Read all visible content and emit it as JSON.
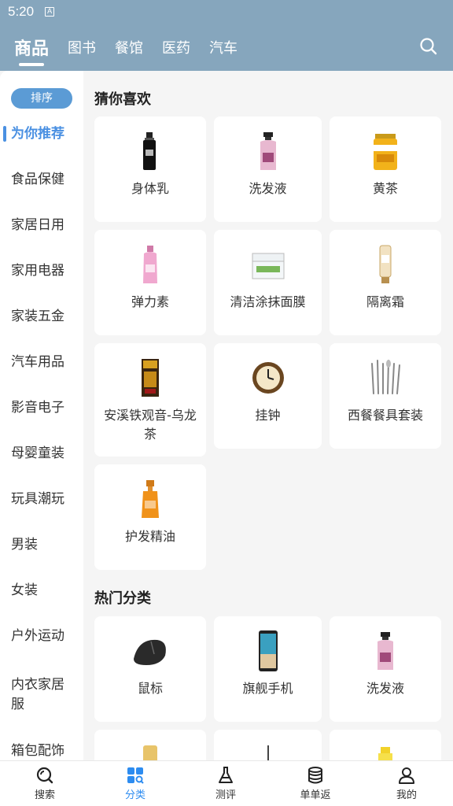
{
  "status": {
    "time": "5:20",
    "sim_label": "A"
  },
  "topnav": {
    "tabs": [
      {
        "label": "商品",
        "active": true
      },
      {
        "label": "图书"
      },
      {
        "label": "餐馆"
      },
      {
        "label": "医药"
      },
      {
        "label": "汽车"
      }
    ],
    "search_icon": "search-icon"
  },
  "sidebar": {
    "sort_label": "排序",
    "items": [
      {
        "label": "为你推荐",
        "active": true
      },
      {
        "label": "食品保健"
      },
      {
        "label": "家居日用"
      },
      {
        "label": "家用电器"
      },
      {
        "label": "家装五金"
      },
      {
        "label": "汽车用品"
      },
      {
        "label": "影音电子"
      },
      {
        "label": "母婴童装"
      },
      {
        "label": "玩具潮玩"
      },
      {
        "label": "男装"
      },
      {
        "label": "女装"
      },
      {
        "label": "户外运动"
      },
      {
        "label": "内衣家居服"
      },
      {
        "label": "箱包配饰"
      }
    ]
  },
  "sections": {
    "guess": {
      "title": "猜你喜欢",
      "items": [
        {
          "label": "身体乳",
          "icon": "body-lotion-bottle-icon"
        },
        {
          "label": "洗发液",
          "icon": "shampoo-bottle-icon"
        },
        {
          "label": "黄茶",
          "icon": "tea-can-icon"
        },
        {
          "label": "弹力素",
          "icon": "pink-bottle-icon"
        },
        {
          "label": "清洁涂抹面膜",
          "icon": "face-mask-jar-icon"
        },
        {
          "label": "隔离霜",
          "icon": "primer-tube-icon"
        },
        {
          "label": "安溪铁观音-乌龙茶",
          "icon": "tea-box-icon"
        },
        {
          "label": "挂钟",
          "icon": "wall-clock-icon"
        },
        {
          "label": "西餐餐具套装",
          "icon": "cutlery-set-icon"
        },
        {
          "label": "护发精油",
          "icon": "hair-oil-bottle-icon"
        }
      ]
    },
    "hot": {
      "title": "热门分类",
      "items": [
        {
          "label": "鼠标",
          "icon": "mouse-icon"
        },
        {
          "label": "旗舰手机",
          "icon": "smartphone-icon"
        },
        {
          "label": "洗发液",
          "icon": "shampoo-bottle-icon"
        }
      ]
    }
  },
  "bottombar": {
    "items": [
      {
        "label": "搜索",
        "icon": "search-icon"
      },
      {
        "label": "分类",
        "icon": "category-icon",
        "active": true
      },
      {
        "label": "测评",
        "icon": "flask-icon"
      },
      {
        "label": "单单返",
        "icon": "database-icon"
      },
      {
        "label": "我的",
        "icon": "user-icon"
      }
    ]
  },
  "colors": {
    "header": "#86a6bd",
    "accent": "#4a90e2",
    "active_tab": "#2d8cf0"
  }
}
